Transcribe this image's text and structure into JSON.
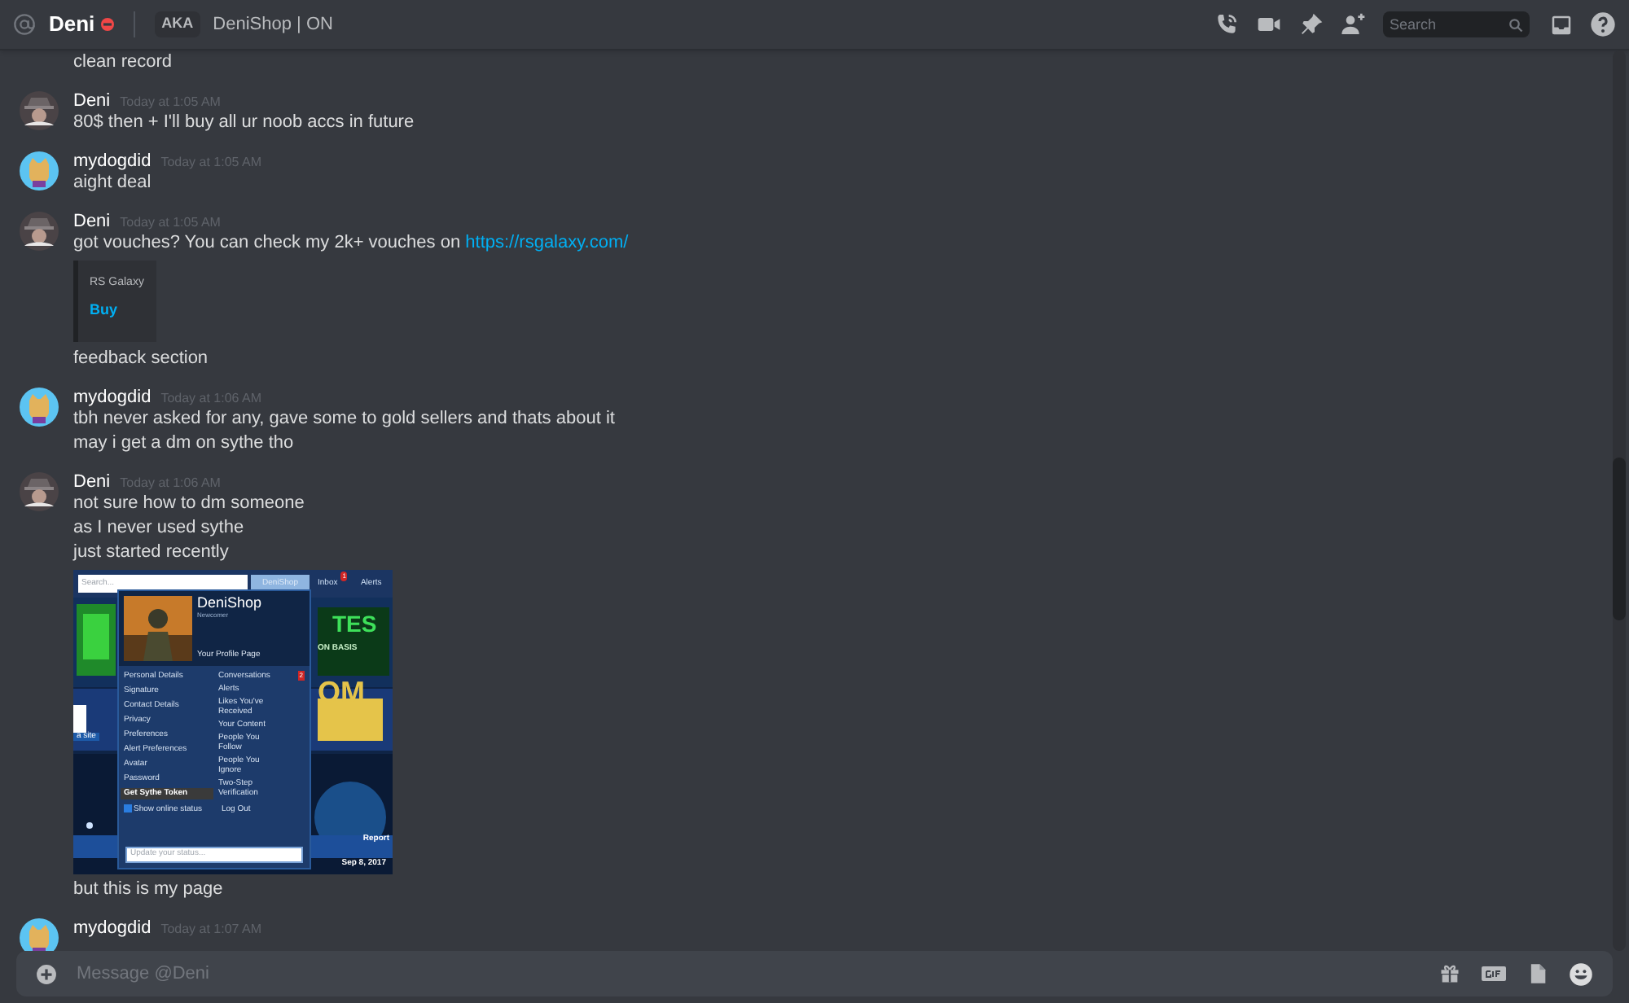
{
  "header": {
    "title": "Deni",
    "status_dot": {
      "color": "#f04747"
    },
    "aka_label": "AKA",
    "aka_names": "DeniShop | ON",
    "search": {
      "placeholder": "Search"
    }
  },
  "messages": [
    {
      "lines": [
        {
          "kind": "text",
          "text": "clean record"
        }
      ]
    },
    {
      "author": "Deni",
      "avatar": {
        "kind": "hat"
      },
      "time": "Today at 1:05 AM",
      "lines": [
        {
          "kind": "text",
          "text": "80$ then + I'll buy all ur noob accs in future"
        }
      ]
    },
    {
      "author": "mydogdid",
      "avatar": {
        "kind": "cat"
      },
      "time": "Today at 1:05 AM",
      "lines": [
        {
          "kind": "text",
          "text": "aight deal"
        }
      ]
    },
    {
      "author": "Deni",
      "avatar": {
        "kind": "hat"
      },
      "time": "Today at 1:05 AM",
      "lines": [
        {
          "kind": "text",
          "text": "got vouches? You can check my 2k+ vouches on ",
          "link": "https://rsgalaxy.com/"
        },
        {
          "kind": "embed",
          "provider": "RS Galaxy",
          "title": "Buy"
        },
        {
          "kind": "text",
          "text": "feedback section"
        }
      ]
    },
    {
      "author": "mydogdid",
      "avatar": {
        "kind": "cat"
      },
      "time": "Today at 1:06 AM",
      "lines": [
        {
          "kind": "text",
          "text": "tbh never asked for any, gave some to gold sellers and thats about it"
        },
        {
          "kind": "text",
          "text": "may i get a dm on sythe tho"
        }
      ]
    },
    {
      "author": "Deni",
      "avatar": {
        "kind": "hat"
      },
      "time": "Today at 1:06 AM",
      "lines": [
        {
          "kind": "text",
          "text": "not sure how to dm someone"
        },
        {
          "kind": "text",
          "text": "as I never used sythe"
        },
        {
          "kind": "text",
          "text": "just started recently"
        },
        {
          "kind": "screenshot",
          "shot": {
            "search_placeholder": "Search...",
            "user_tab": "DeniShop",
            "inbox": "Inbox",
            "inbox_badge": "1",
            "alerts": "Alerts",
            "banner_texts": [
              "TES",
              "ON BASIS",
              "OM",
              "a site"
            ],
            "menu": {
              "username": "DeniShop",
              "rank": "Newcomer",
              "profile_link": "Your Profile Page",
              "left": [
                {
                  "label": "Personal Details"
                },
                {
                  "label": "Signature"
                },
                {
                  "label": "Contact Details"
                },
                {
                  "label": "Privacy"
                },
                {
                  "label": "Preferences"
                },
                {
                  "label": "Alert Preferences"
                },
                {
                  "label": "Avatar"
                },
                {
                  "label": "Password"
                },
                {
                  "label": "Get Sythe Token",
                  "kind": "button"
                }
              ],
              "right": [
                {
                  "label": "Conversations",
                  "badge": "2"
                },
                {
                  "label": "Alerts"
                },
                {
                  "label": "Likes You've Received"
                },
                {
                  "label": "Your Content"
                },
                {
                  "label": "People You Follow"
                },
                {
                  "label": "People You Ignore"
                },
                {
                  "label": "Two-Step Verification"
                }
              ],
              "show_online": {
                "label": "Show online status",
                "checked": true
              },
              "logout": "Log Out",
              "status_placeholder": "Update your status..."
            },
            "report": "Report",
            "date": "Sep 8, 2017"
          }
        },
        {
          "kind": "text",
          "text": "but this is my page"
        }
      ]
    },
    {
      "author": "mydogdid",
      "avatar": {
        "kind": "cat"
      },
      "time": "Today at 1:07 AM"
    }
  ],
  "composer": {
    "placeholder": "Message @Deni"
  }
}
